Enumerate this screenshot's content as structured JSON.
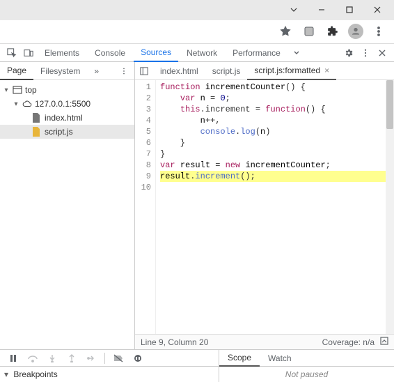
{
  "window": {
    "minimize_title": "Minimize",
    "maximize_title": "Maximize",
    "close_title": "Close"
  },
  "devtools": {
    "tabs": [
      "Elements",
      "Console",
      "Sources",
      "Network",
      "Performance"
    ],
    "active_tab": "Sources"
  },
  "sources_left_tabs": {
    "page": "Page",
    "filesystem": "Filesystem"
  },
  "tree": {
    "root": "top",
    "origin": "127.0.0.1:5500",
    "files": [
      "index.html",
      "script.js"
    ],
    "selected": "script.js"
  },
  "file_tabs": {
    "items": [
      "index.html",
      "script.js",
      "script.js:formatted"
    ],
    "active": "script.js:formatted"
  },
  "code": {
    "lines": [
      "function incrementCounter() {",
      "    var n = 0;",
      "    this.increment = function() {",
      "        n++,",
      "        console.log(n)",
      "    }",
      "}",
      "var result = new incrementCounter;",
      "result.increment();",
      ""
    ],
    "highlight_line": 9
  },
  "status": {
    "cursor": "Line 9, Column 20",
    "coverage": "Coverage: n/a"
  },
  "debug_tabs": {
    "scope": "Scope",
    "watch": "Watch"
  },
  "bottom": {
    "breakpoints_label": "Breakpoints",
    "not_paused": "Not paused"
  }
}
